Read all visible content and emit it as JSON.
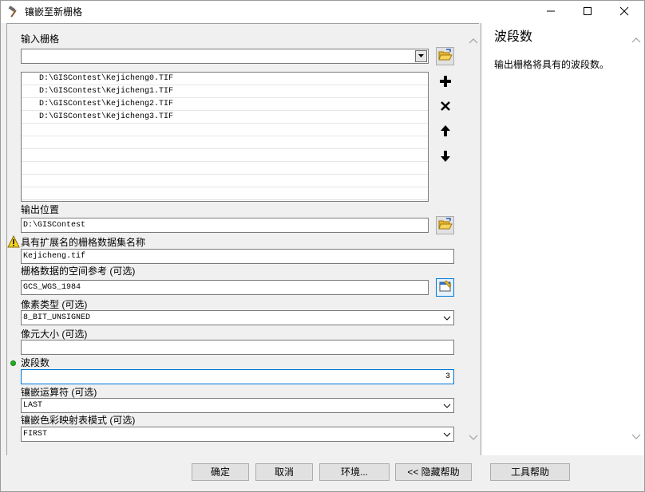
{
  "window": {
    "title": "镶嵌至新栅格",
    "minimize_icon": "minimize-icon",
    "maximize_icon": "maximize-icon",
    "close_icon": "close-icon"
  },
  "form": {
    "input_rasters_label": "输入栅格",
    "input_rasters_value": "",
    "input_rasters_list": [
      "D:\\GISContest\\Kejicheng0.TIF",
      "D:\\GISContest\\Kejicheng1.TIF",
      "D:\\GISContest\\Kejicheng2.TIF",
      "D:\\GISContest\\Kejicheng3.TIF"
    ],
    "output_location_label": "输出位置",
    "output_location_value": "D:\\GISContest",
    "dataset_name_label": "具有扩展名的栅格数据集名称",
    "dataset_name_value": "Kejicheng.tif",
    "spatial_ref_label": "栅格数据的空间参考 (可选)",
    "spatial_ref_value": "GCS_WGS_1984",
    "pixel_type_label": "像素类型 (可选)",
    "pixel_type_value": "8_BIT_UNSIGNED",
    "cellsize_label": "像元大小 (可选)",
    "cellsize_value": "",
    "bands_label": "波段数",
    "bands_value": "3",
    "mosaic_operator_label": "镶嵌运算符 (可选)",
    "mosaic_operator_value": "LAST",
    "colormap_mode_label": "镶嵌色彩映射表模式 (可选)",
    "colormap_mode_value": "FIRST"
  },
  "help": {
    "title": "波段数",
    "text": "输出栅格将具有的波段数。"
  },
  "buttons": {
    "ok": "确定",
    "cancel": "取消",
    "environments": "环境...",
    "hide_help": "<< 隐藏帮助",
    "tool_help": "工具帮助"
  },
  "colors": {
    "accent": "#0078d7",
    "required_dot": "#22b022",
    "warning": "#f7d51d"
  }
}
